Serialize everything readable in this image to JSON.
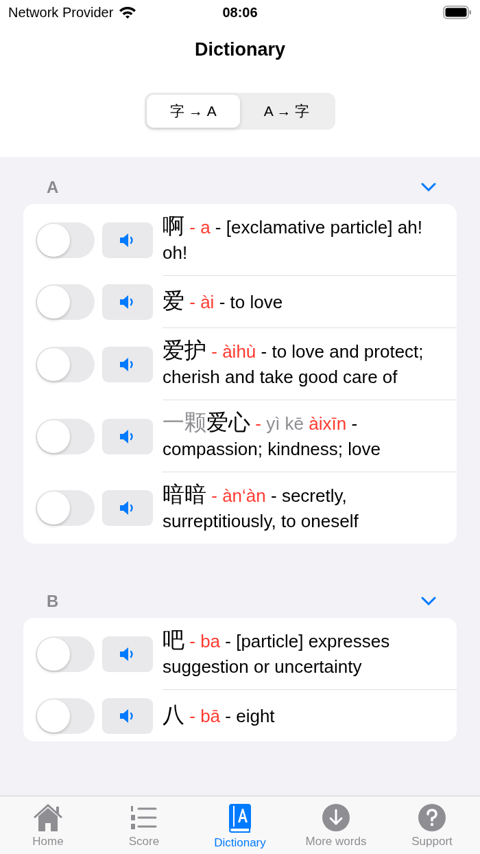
{
  "status_bar": {
    "carrier": "Network Provider",
    "time": "08:06"
  },
  "nav": {
    "title": "Dictionary"
  },
  "segments": [
    {
      "label": "字 → A",
      "selected": true
    },
    {
      "label": "A → 字",
      "selected": false
    }
  ],
  "sections": [
    {
      "letter": "A",
      "expanded": true,
      "entries": [
        {
          "on": false,
          "hanzi": [
            {
              "text": "啊",
              "dim": false
            }
          ],
          "dash": "-",
          "pinyin": [
            {
              "text": "a",
              "dim": false
            }
          ],
          "definition": "- [exclamative particle] ah! oh!"
        },
        {
          "on": false,
          "hanzi": [
            {
              "text": "爱",
              "dim": false
            }
          ],
          "dash": "-",
          "pinyin": [
            {
              "text": "ài",
              "dim": false
            }
          ],
          "definition": " - to love"
        },
        {
          "on": false,
          "hanzi": [
            {
              "text": "爱护",
              "dim": false
            }
          ],
          "dash": "-",
          "pinyin": [
            {
              "text": "àihù",
              "dim": false
            }
          ],
          "definition": "- to love and protect; cherish and take good care of"
        },
        {
          "on": false,
          "hanzi": [
            {
              "text": "一颗",
              "dim": true
            },
            {
              "text": "爱心",
              "dim": false
            }
          ],
          "dash": "-",
          "pinyin": [
            {
              "text": "yì kē",
              "dim": true
            },
            {
              "text": "àixīn",
              "dim": false
            }
          ],
          "definition": "- compassion; kindness; love"
        },
        {
          "on": false,
          "hanzi": [
            {
              "text": "暗暗",
              "dim": false
            }
          ],
          "dash": "-",
          "pinyin": [
            {
              "text": "àn‘àn",
              "dim": false
            }
          ],
          "definition": "- secretly, surreptitiously, to oneself"
        }
      ]
    },
    {
      "letter": "B",
      "expanded": true,
      "entries": [
        {
          "on": false,
          "hanzi": [
            {
              "text": "吧",
              "dim": false
            }
          ],
          "dash": "-",
          "pinyin": [
            {
              "text": "ba",
              "dim": false
            }
          ],
          "definition": "- [particle] expresses suggestion or uncertainty"
        },
        {
          "on": false,
          "hanzi": [
            {
              "text": "八",
              "dim": false
            }
          ],
          "dash": "-",
          "pinyin": [
            {
              "text": "bā",
              "dim": false
            }
          ],
          "definition": "- eight"
        }
      ]
    }
  ],
  "tabs": [
    {
      "kind": "home",
      "label": "Home",
      "selected": false
    },
    {
      "kind": "score",
      "label": "Score",
      "selected": false
    },
    {
      "kind": "dictionary",
      "label": "Dictionary",
      "selected": true
    },
    {
      "kind": "download",
      "label": "More words",
      "selected": false
    },
    {
      "kind": "help",
      "label": "Support",
      "selected": false
    }
  ]
}
